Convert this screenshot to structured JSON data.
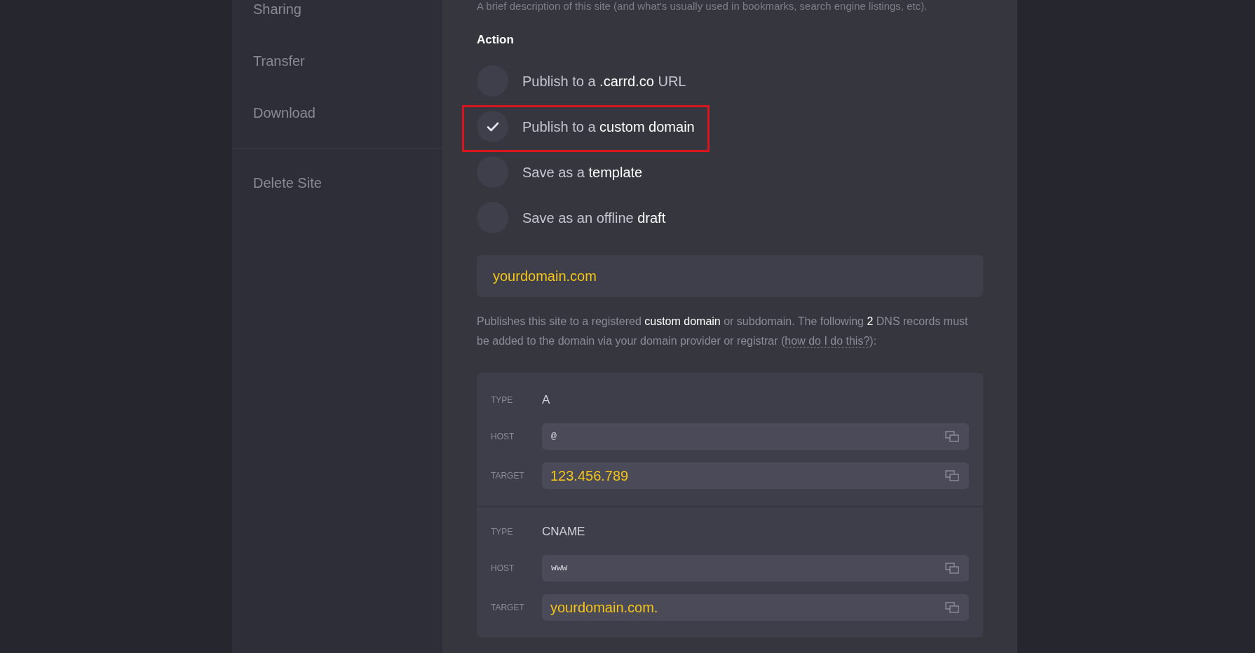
{
  "sidebar": {
    "items": [
      {
        "label": "Sharing"
      },
      {
        "label": "Transfer"
      },
      {
        "label": "Download"
      }
    ],
    "footer_items": [
      {
        "label": "Delete Site"
      }
    ]
  },
  "main": {
    "previous_field_hint": "A brief description of this site (and what's usually used in bookmarks, search engine listings, etc).",
    "action": {
      "heading": "Action",
      "options": [
        {
          "label": "Publish to a **.carrd.co** URL",
          "selected": false,
          "highlighted": false
        },
        {
          "label": "Publish to a **custom domain**",
          "selected": true,
          "highlighted": true
        },
        {
          "label": "Save as a **template**",
          "selected": false,
          "highlighted": false
        },
        {
          "label": "Save as an offline **draft**",
          "selected": false,
          "highlighted": false
        }
      ]
    },
    "domain_field": {
      "value": "yourdomain.com"
    },
    "help_text": {
      "text": "Publishes this site to a registered **custom domain** or subdomain. The following **2** DNS records must be added to the domain via your domain provider or registrar (",
      "link": "how do I do this?",
      "text_after": "):"
    },
    "dns_records": [
      {
        "type_label": "TYPE",
        "type": "A",
        "host_label": "HOST",
        "host": "@",
        "target_label": "TARGET",
        "target": "123.456.789"
      },
      {
        "type_label": "TYPE",
        "type": "CNAME",
        "host_label": "HOST",
        "host": "www",
        "target_label": "TARGET",
        "target": "yourdomain.com."
      }
    ]
  }
}
